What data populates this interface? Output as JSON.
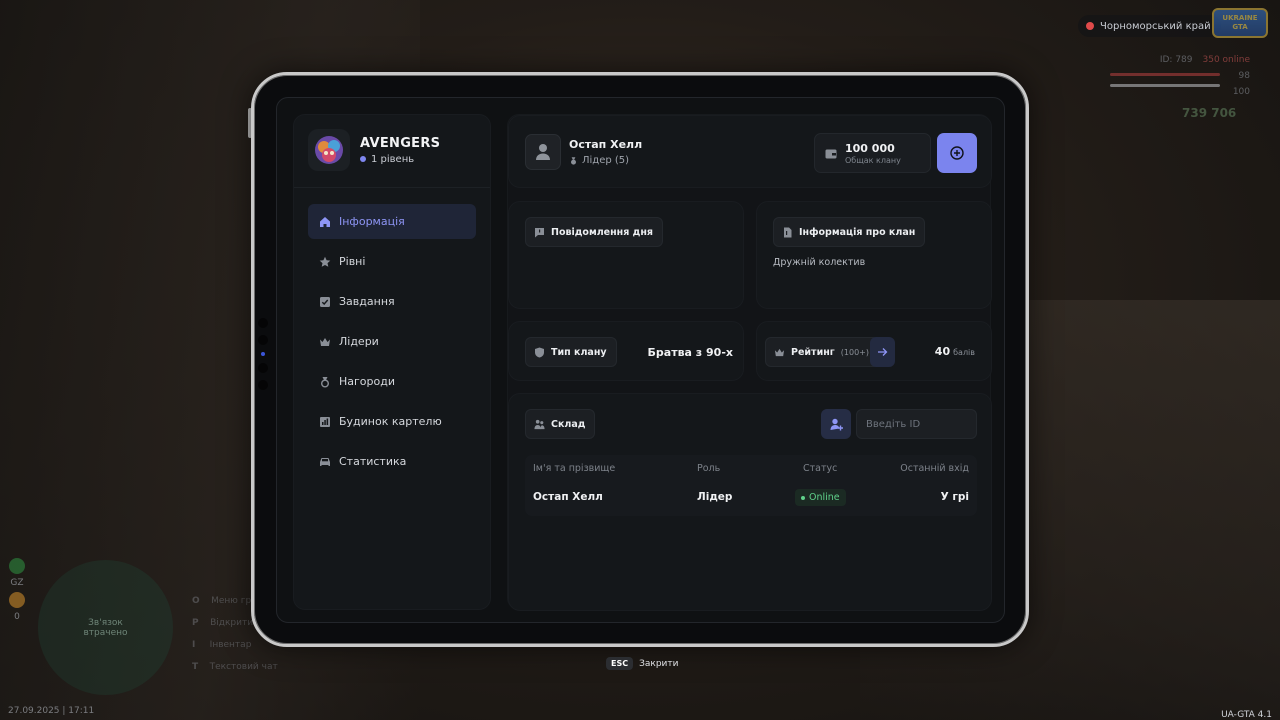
{
  "hud": {
    "region": "Чорноморський край",
    "logo": "UKRAINE GTA",
    "id": "ID: 789",
    "online": "350 online",
    "health": "98",
    "armor": "100",
    "money": "739 706",
    "minimap_text": "Зв'язок втрачено",
    "gz": "GZ",
    "zero": "0",
    "hints": [
      {
        "key": "O",
        "text": "Меню гравця"
      },
      {
        "key": "P",
        "text": "Відкрити телефон"
      },
      {
        "key": "I",
        "text": "Інвентар"
      },
      {
        "key": "T",
        "text": "Текстовий чат"
      }
    ],
    "date": "27.09.2025 | 17:11",
    "version": "UA-GTA 4.1"
  },
  "sidebar": {
    "clan_name": "AVENGERS",
    "clan_level": "1 рівень",
    "items": [
      {
        "label": "Інформація",
        "icon": "home-icon",
        "active": true
      },
      {
        "label": "Рівні",
        "icon": "star-icon"
      },
      {
        "label": "Завдання",
        "icon": "checkbox-icon"
      },
      {
        "label": "Лідери",
        "icon": "crown-icon"
      },
      {
        "label": "Нагороди",
        "icon": "medal-icon"
      },
      {
        "label": "Будинок картелю",
        "icon": "building-icon"
      },
      {
        "label": "Статистика",
        "icon": "car-icon"
      }
    ]
  },
  "user": {
    "name": "Остап Хелл",
    "role": "Лідер (5)"
  },
  "bank": {
    "value": "100 000",
    "label": "Общак клану"
  },
  "message_of_day": {
    "title": "Повідомлення дня"
  },
  "clan_info": {
    "title": "Інформація про клан",
    "text": "Дружній колектив"
  },
  "clan_type": {
    "label": "Тип клану",
    "value": "Братва з 90-х"
  },
  "rating": {
    "label": "Рейтинг",
    "sub": "(100+)",
    "points": "40",
    "points_unit": "балів"
  },
  "warehouse": {
    "title": "Склад",
    "input_placeholder": "Введіть ID",
    "columns": [
      "Ім'я та прізвище",
      "Роль",
      "Статус",
      "Останній вхід"
    ],
    "rows": [
      {
        "name": "Остап Хелл",
        "role": "Лідер",
        "status": "Online",
        "last_login": "У грі"
      }
    ]
  },
  "footer": {
    "esc_key": "ESC",
    "close_label": "Закрити"
  },
  "colors": {
    "accent": "#7b84ee",
    "online": "#5fd08a",
    "panel": "#14171a"
  }
}
